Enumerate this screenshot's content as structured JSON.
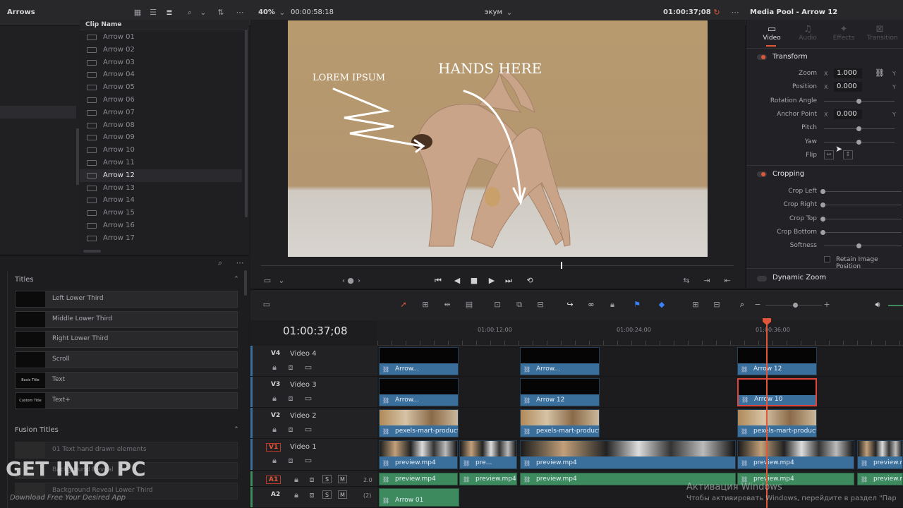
{
  "top": {
    "bin_title": "Arrows",
    "zoom": "40%",
    "duration": "00:00:58:18",
    "viewer_label": "экум",
    "timecode": "01:00:37;08",
    "inspector_title": "Media Pool - Arrow 12"
  },
  "media_pool": {
    "header": "Clip Name",
    "clips": [
      {
        "name": "Arrow 01",
        "selected": false
      },
      {
        "name": "Arrow 02",
        "selected": false
      },
      {
        "name": "Arrow 03",
        "selected": false
      },
      {
        "name": "Arrow 04",
        "selected": false
      },
      {
        "name": "Arrow 05",
        "selected": false
      },
      {
        "name": "Arrow 06",
        "selected": false
      },
      {
        "name": "Arrow 07",
        "selected": false
      },
      {
        "name": "Arrow 08",
        "selected": false
      },
      {
        "name": "Arrow 09",
        "selected": false
      },
      {
        "name": "Arrow 10",
        "selected": false
      },
      {
        "name": "Arrow 11",
        "selected": false
      },
      {
        "name": "Arrow 12",
        "selected": true
      },
      {
        "name": "Arrow 13",
        "selected": false
      },
      {
        "name": "Arrow 14",
        "selected": false
      },
      {
        "name": "Arrow 15",
        "selected": false
      },
      {
        "name": "Arrow 16",
        "selected": false
      },
      {
        "name": "Arrow 17",
        "selected": false
      }
    ]
  },
  "effects": {
    "titles_heading": "Titles",
    "titles": [
      {
        "thumb": "",
        "label": "Left Lower Third"
      },
      {
        "thumb": "",
        "label": "Middle Lower Third"
      },
      {
        "thumb": "",
        "label": "Right Lower Third"
      },
      {
        "thumb": "",
        "label": "Scroll"
      },
      {
        "thumb": "Basic Title",
        "label": "Text"
      },
      {
        "thumb": "Custom Title",
        "label": "Text+"
      }
    ],
    "fusion_heading": "Fusion Titles",
    "fusion": [
      {
        "label": "01 Text hand drawn elements"
      },
      {
        "label": "Background Reveal"
      },
      {
        "label": "Background Reveal Lower Third"
      }
    ]
  },
  "video_overlay": {
    "text1": "LOREM IPSUM",
    "text2": "HANDS HERE"
  },
  "inspector": {
    "tabs": [
      "Video",
      "Audio",
      "Effects",
      "Transition"
    ],
    "active_tab": "Video",
    "transform_heading": "Transform",
    "zoom_label": "Zoom",
    "zoom_x": "1.000",
    "position_label": "Position",
    "position_x": "0.000",
    "rotation_label": "Rotation Angle",
    "anchor_label": "Anchor Point",
    "anchor_x": "0.000",
    "pitch_label": "Pitch",
    "yaw_label": "Yaw",
    "flip_label": "Flip",
    "x_letter": "X",
    "y_letter": "Y",
    "cropping_heading": "Cropping",
    "crop_left": "Crop Left",
    "crop_right": "Crop Right",
    "crop_top": "Crop Top",
    "crop_bottom": "Crop Bottom",
    "softness": "Softness",
    "retain_label": "Retain Image Position",
    "dynamic_zoom": "Dynamic Zoom"
  },
  "timeline": {
    "timecode": "01:00:37;08",
    "ruler": [
      "01:00:12;00",
      "01:00:24;00",
      "01:00:36;00"
    ],
    "tracks": [
      {
        "id": "V4",
        "name": "Video 4"
      },
      {
        "id": "V3",
        "name": "Video 3"
      },
      {
        "id": "V2",
        "name": "Video 2"
      },
      {
        "id": "V1",
        "name": "Video 1"
      },
      {
        "id": "A1",
        "name": "",
        "level": "2.0",
        "s": "S",
        "m": "M"
      },
      {
        "id": "A2",
        "name": "",
        "level": "(2)",
        "s": "S",
        "m": "M"
      }
    ],
    "clips": {
      "v4": [
        "Arrow...",
        "Arrow...",
        "Arrow 12"
      ],
      "v3": [
        "Arrow...",
        "Arrow 12",
        "Arrow 10"
      ],
      "v2": [
        "pexels-mart-production...",
        "pexels-mart-production-...",
        "pexels-mart-production-..."
      ],
      "v1": [
        "preview.mp4",
        "pre...",
        "preview.mp4",
        "preview.mp4",
        "preview.m"
      ],
      "a1": [
        "preview.mp4",
        "preview.mp4",
        "preview.mp4",
        "preview.mp4",
        "preview.m"
      ],
      "a2": [
        "Arrow 01"
      ]
    }
  },
  "watermark": {
    "logo": "GET INTO PC",
    "tagline": "Download Free Your Desired App",
    "activation_title": "Активация Windows",
    "activation_sub": "Чтобы активировать Windows, перейдите в раздел \"Пар"
  },
  "colors": {
    "accent": "#e2573a",
    "video_clip": "#3a6e9b",
    "audio_clip": "#3d8a5f"
  }
}
